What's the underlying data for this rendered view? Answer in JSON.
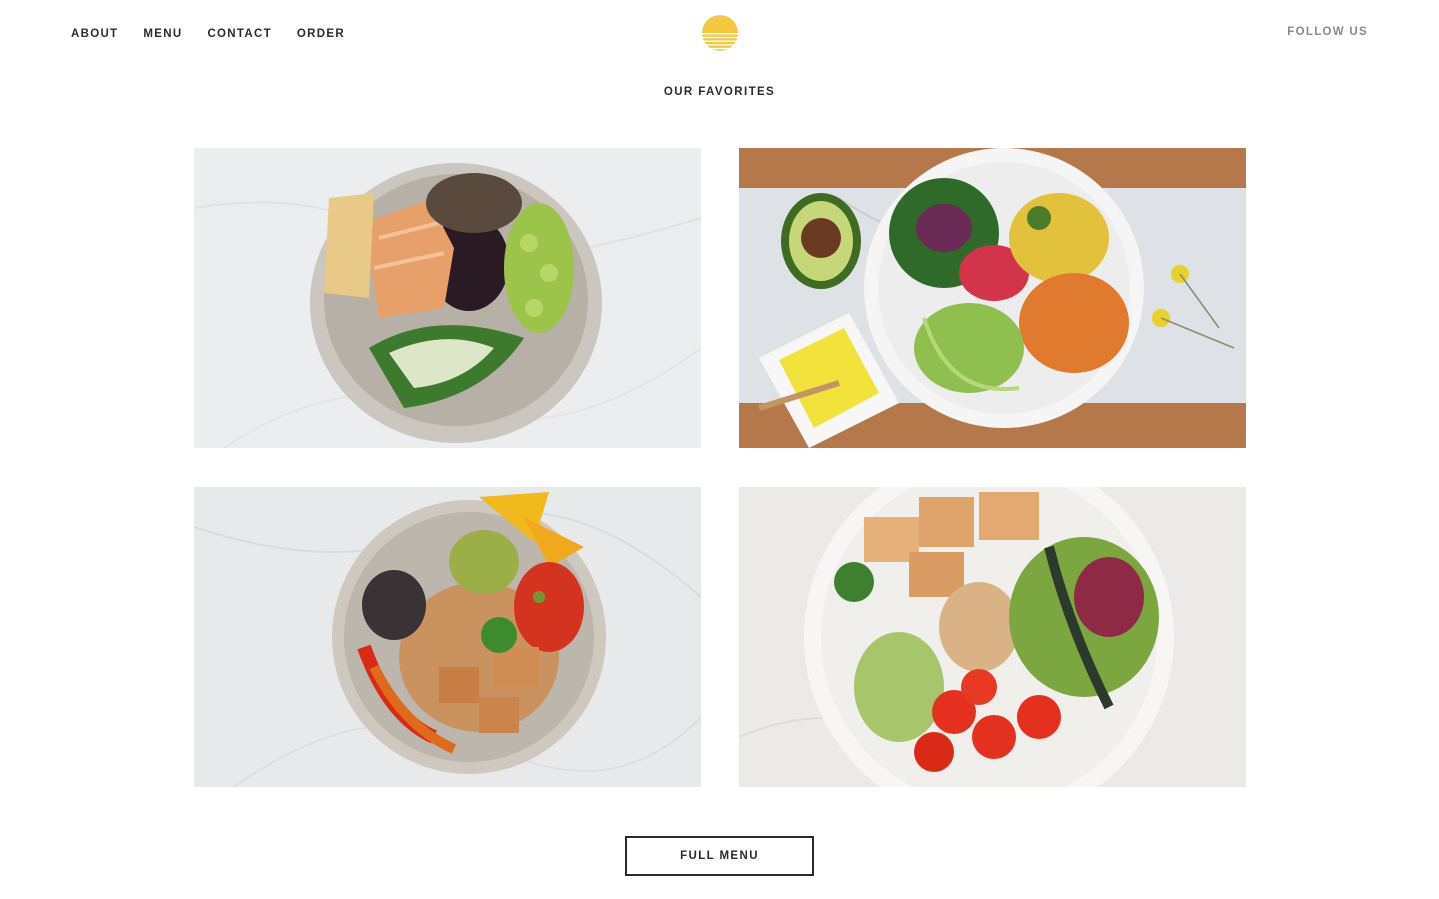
{
  "header": {
    "nav": [
      {
        "label": "ABOUT"
      },
      {
        "label": "MENU"
      },
      {
        "label": "CONTACT"
      },
      {
        "label": "ORDER"
      }
    ],
    "logo_icon": "sun-logo-icon",
    "follow_label": "FOLLOW US"
  },
  "favorites": {
    "title": "OUR FAVORITES",
    "items": [
      {
        "image": "salmon-rice-edamame-bowl"
      },
      {
        "image": "roasted-veggie-avocado-bowl"
      },
      {
        "image": "burrito-bowl-guacamole"
      },
      {
        "image": "tofu-salad-tomato-bowl"
      }
    ]
  },
  "cta": {
    "label": "FULL MENU"
  },
  "colors": {
    "brand_yellow": "#F5C842",
    "text_dark": "#2B2B2B",
    "text_muted": "#8A8A8A",
    "background": "#FFFFFF"
  }
}
